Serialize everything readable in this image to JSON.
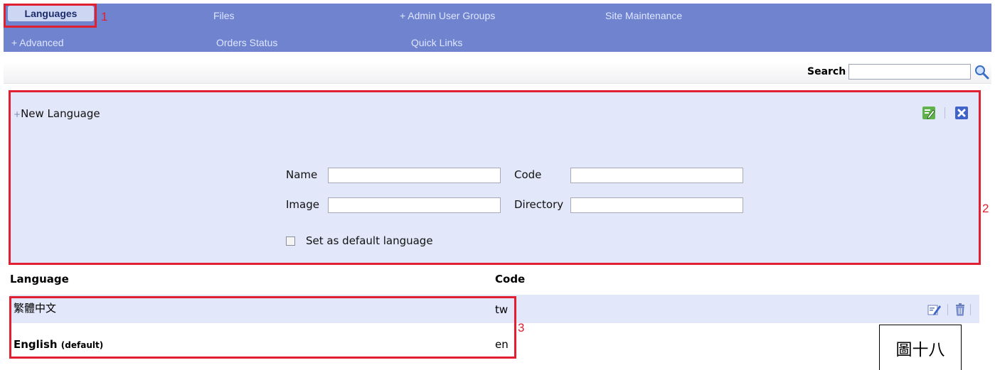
{
  "nav": {
    "row1": [
      "Languages",
      "Files",
      "+ Admin User Groups",
      "Site Maintenance"
    ],
    "row2": [
      "+ Advanced",
      "Orders Status",
      "Quick Links"
    ],
    "active": "Languages"
  },
  "annotations": {
    "box1": "1",
    "box2": "2",
    "box3": "3"
  },
  "search": {
    "label": "Search",
    "value": ""
  },
  "new_language": {
    "title": "New Language",
    "fields": {
      "name_label": "Name",
      "code_label": "Code",
      "image_label": "Image",
      "directory_label": "Directory",
      "name_value": "",
      "code_value": "",
      "image_value": "",
      "directory_value": ""
    },
    "default_checkbox_label": "Set as default language",
    "default_checked": false
  },
  "table": {
    "headers": [
      "Language",
      "Code"
    ],
    "rows": [
      {
        "language": "繁體中文",
        "code": "tw"
      },
      {
        "language": "English",
        "tag": "(default)",
        "code": "en"
      }
    ]
  },
  "caption": "圖十八",
  "colors": {
    "nav_bg": "#6f83cf",
    "panel_bg": "#e3e7fa",
    "annotation": "#e02030"
  }
}
